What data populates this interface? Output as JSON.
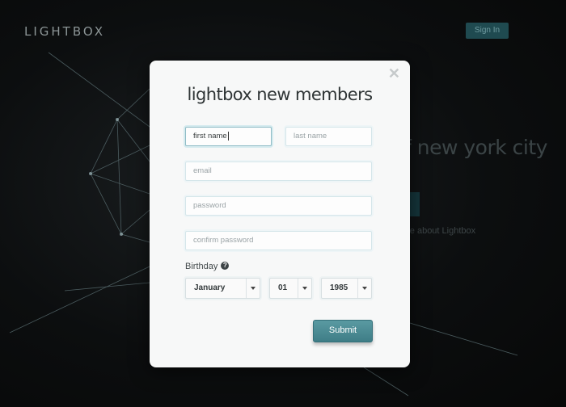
{
  "background": {
    "logo": "LIGHTBOX",
    "signin_label": "Sign In",
    "headline_fragment": "f new york city",
    "learn_fragment": "ore about Lightbox"
  },
  "modal": {
    "close_glyph": "✕",
    "title": "lightbox new members",
    "fields": {
      "first_name_value": "first name",
      "last_name_placeholder": "last name",
      "email_placeholder": "email",
      "password_placeholder": "password",
      "confirm_password_placeholder": "confirm password"
    },
    "birthday_label": "Birthday",
    "help_glyph": "?",
    "birthday": {
      "month": "January",
      "day": "01",
      "year": "1985"
    },
    "submit_label": "Submit"
  },
  "colors": {
    "accent": "#4a8c95",
    "modal_bg": "#f7f8f8",
    "page_bg": "#0b0d0e"
  }
}
